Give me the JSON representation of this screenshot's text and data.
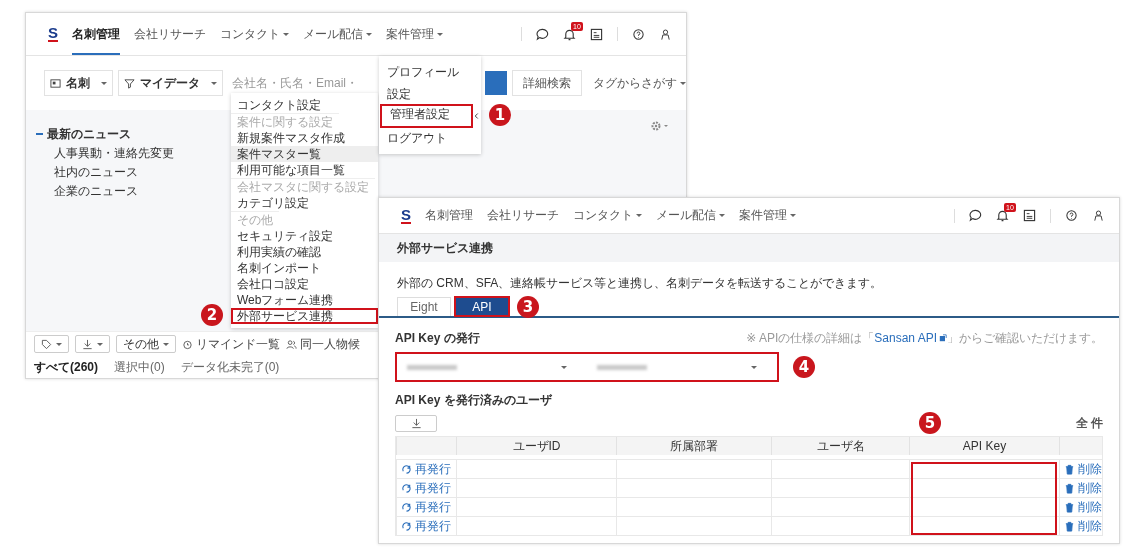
{
  "back": {
    "nav": {
      "logo": "S",
      "items": [
        {
          "label": "名刺管理",
          "selected": true,
          "dropdown": false
        },
        {
          "label": "会社リサーチ",
          "selected": false,
          "dropdown": false
        },
        {
          "label": "コンタクト",
          "selected": false,
          "dropdown": true
        },
        {
          "label": "メール配信",
          "selected": false,
          "dropdown": true
        },
        {
          "label": "案件管理",
          "selected": false,
          "dropdown": true
        }
      ],
      "notification_badge": "10"
    },
    "search": {
      "type_select": "名刺",
      "scope_select": "マイデータ",
      "placeholder": "会社名・氏名・Email・",
      "advanced_button": "詳細検索",
      "tag_filter": "タグからさがす"
    },
    "news": {
      "title": "最新のニュース",
      "expanded": true,
      "items": [
        "人事異動・連絡先変更",
        "社内のニュース",
        "企業のニュース"
      ]
    },
    "toolbar": [
      {
        "kind": "tag-menu"
      },
      {
        "kind": "download-menu"
      },
      {
        "kind": "menu",
        "label": "その他"
      },
      {
        "kind": "reminder",
        "label": "リマインド一覧"
      },
      {
        "kind": "person",
        "label": "同一人物候"
      }
    ],
    "tabs": [
      {
        "label": "すべて(260)",
        "selected": true
      },
      {
        "label": "選択中(0)",
        "selected": false
      },
      {
        "label": "データ化未完了(0)",
        "selected": false
      }
    ],
    "profile_menu": [
      {
        "label": "プロフィール",
        "highlighted": false,
        "has_submenu": false
      },
      {
        "label": "設定",
        "highlighted": false,
        "has_submenu": false
      },
      {
        "label": "管理者設定",
        "highlighted": true,
        "has_submenu": true,
        "step": "1"
      },
      {
        "label": "ログアウト",
        "highlighted": false,
        "has_submenu": false
      }
    ],
    "admin_menu": [
      {
        "kind": "item",
        "label": "コンタクト設定",
        "hovered": false,
        "highlighted": false
      },
      {
        "kind": "header",
        "label": "案件に関する設定"
      },
      {
        "kind": "item",
        "label": "新規案件マスタ作成",
        "hovered": false,
        "highlighted": false
      },
      {
        "kind": "item",
        "label": "案件マスター覧",
        "hovered": true,
        "highlighted": false
      },
      {
        "kind": "item",
        "label": "利用可能な項目一覧",
        "hovered": false,
        "highlighted": false
      },
      {
        "kind": "header",
        "label": "会社マスタに関する設定"
      },
      {
        "kind": "item",
        "label": "カテゴリ設定",
        "hovered": false,
        "highlighted": false
      },
      {
        "kind": "header",
        "label": "その他"
      },
      {
        "kind": "item",
        "label": "セキュリティ設定",
        "hovered": false,
        "highlighted": false
      },
      {
        "kind": "item",
        "label": "利用実績の確認",
        "hovered": false,
        "highlighted": false
      },
      {
        "kind": "item",
        "label": "名刺インポート",
        "hovered": false,
        "highlighted": false
      },
      {
        "kind": "item",
        "label": "会社口コ設定",
        "hovered": false,
        "highlighted": false
      },
      {
        "kind": "item",
        "label": "Webフォーム連携",
        "hovered": false,
        "highlighted": false
      },
      {
        "kind": "item",
        "label": "外部サービス連携",
        "hovered": false,
        "highlighted": true,
        "step": "2"
      }
    ]
  },
  "front": {
    "nav": {
      "logo": "S",
      "items": [
        {
          "label": "名刺管理",
          "selected": false,
          "dropdown": false
        },
        {
          "label": "会社リサーチ",
          "selected": false,
          "dropdown": false
        },
        {
          "label": "コンタクト",
          "selected": false,
          "dropdown": true
        },
        {
          "label": "メール配信",
          "selected": false,
          "dropdown": true
        },
        {
          "label": "案件管理",
          "selected": false,
          "dropdown": true
        }
      ],
      "notification_badge": "10"
    },
    "page_title": "外部サービス連携",
    "description": "外部の CRM、SFA、連絡帳サービス等と連携し、名刺データを転送することができます。",
    "tabs": [
      {
        "label": "Eight",
        "selected": false,
        "highlighted": false
      },
      {
        "label": "API",
        "selected": true,
        "highlighted": true,
        "step": "3"
      }
    ],
    "issue_section": {
      "title": "API Key の発行",
      "note": {
        "before": "※ APIの仕様の詳細は「",
        "link": "Sansan API",
        "after": "」からご確認いただけます。"
      },
      "highlighted": true,
      "step": "4"
    },
    "users_section": {
      "title": "API Key を発行済みのユーザ",
      "count": "全 件"
    },
    "table": {
      "columns": [
        {
          "label": "ユーザID"
        },
        {
          "label": "所属部署"
        },
        {
          "label": "ユーザ名"
        },
        {
          "label": "API Key",
          "highlighted": true,
          "step": "5"
        }
      ],
      "rows": [
        {
          "reissue": "再発行",
          "delete": "削除"
        },
        {
          "reissue": "再発行",
          "delete": "削除"
        },
        {
          "reissue": "再発行",
          "delete": "削除"
        },
        {
          "reissue": "再発行",
          "delete": "削除"
        }
      ]
    }
  }
}
